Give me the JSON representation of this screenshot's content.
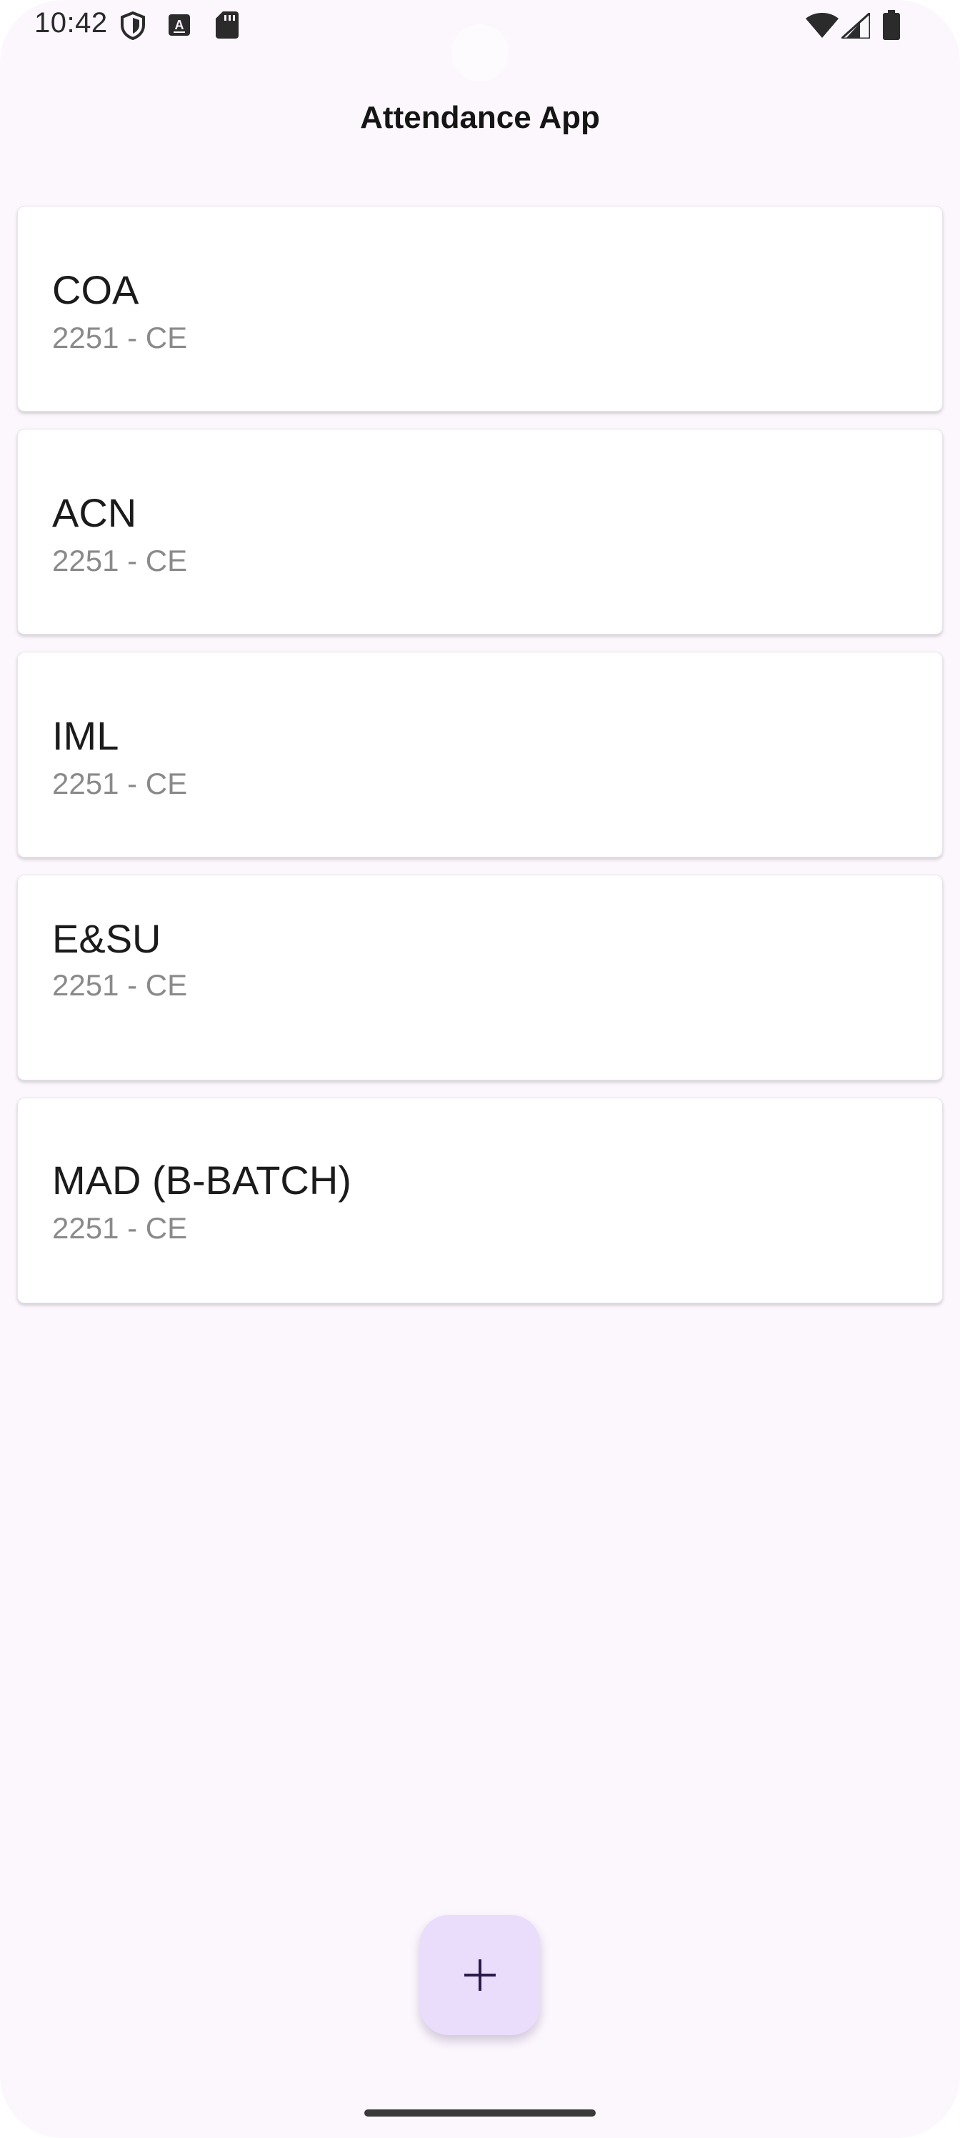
{
  "status_bar": {
    "time": "10:42",
    "left_icons": [
      "shield-icon",
      "keyboard-a-icon",
      "sd-card-icon"
    ],
    "right_icons": [
      "wifi-icon",
      "signal-icon",
      "battery-icon"
    ]
  },
  "header": {
    "title": "Attendance App"
  },
  "courses": [
    {
      "name": "COA",
      "code": "2251 - CE"
    },
    {
      "name": "ACN",
      "code": "2251 - CE"
    },
    {
      "name": "IML",
      "code": "2251 - CE"
    },
    {
      "name": "E&SU",
      "code": "2251 - CE"
    },
    {
      "name": "MAD (B-BATCH)",
      "code": "2251 - CE"
    }
  ],
  "fab": {
    "icon": "plus-icon"
  },
  "colors": {
    "background": "#fcf6fd",
    "card": "#ffffff",
    "fab": "#eaddfc",
    "fab_icon": "#2a1a4a",
    "secondary_text": "#8a8a8a"
  }
}
